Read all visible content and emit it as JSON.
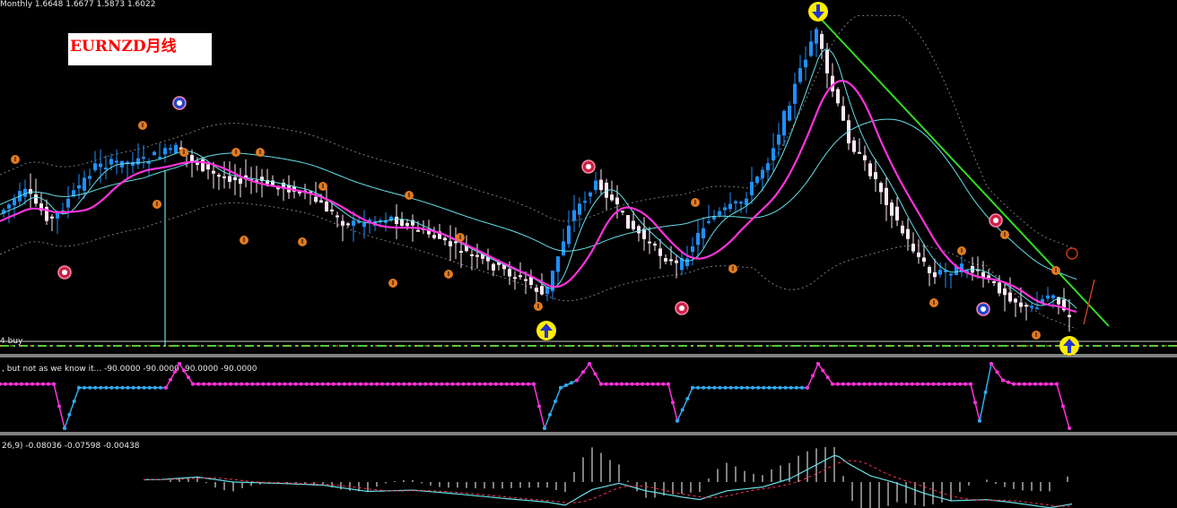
{
  "main_panel": {
    "header": "Monthly  1.6648 1.6677 1.5873 1.6022",
    "title": "EURNZD月线",
    "buy_label": "4 buy"
  },
  "indicator_panel": {
    "header": ", but not as we know it...  -90.0000 -90.0000 -90.0000 -90.0000"
  },
  "macd_panel": {
    "header": "26,9)  -0.08036 -0.07598 -0.00438"
  },
  "colors": {
    "background": "#000000",
    "bull_candle": "#1e90ff",
    "bear_candle": "#ffe8f4",
    "ma_main": "#ff33dd",
    "ma_fast": "#66e0e8",
    "bands": "#7a7a7a",
    "trendline": "#33dd22",
    "buy_line": "#44cc44",
    "support_line": "#e0a020",
    "fractal": "#e07a20",
    "arrow_marker": "#ffee00",
    "osc_pink": "#ff33dd",
    "osc_blue": "#33aaee",
    "macd_signal": "#ff3355"
  },
  "chart_data": [
    {
      "type": "line",
      "panel": "price",
      "symbol": "EURNZD",
      "timeframe": "Monthly",
      "ohlc_last": {
        "open": 1.6648,
        "high": 1.6677,
        "low": 1.5873,
        "close": 1.6022
      },
      "trend": {
        "price_path_points": [
          [
            0,
            0.62
          ],
          [
            30,
            0.55
          ],
          [
            60,
            0.64
          ],
          [
            110,
            0.47
          ],
          [
            160,
            0.46
          ],
          [
            200,
            0.42
          ],
          [
            240,
            0.5
          ],
          [
            290,
            0.52
          ],
          [
            340,
            0.55
          ],
          [
            390,
            0.65
          ],
          [
            440,
            0.63
          ],
          [
            490,
            0.69
          ],
          [
            540,
            0.76
          ],
          [
            590,
            0.82
          ],
          [
            610,
            0.87
          ],
          [
            640,
            0.62
          ],
          [
            670,
            0.52
          ],
          [
            700,
            0.64
          ],
          [
            740,
            0.74
          ],
          [
            760,
            0.78
          ],
          [
            790,
            0.64
          ],
          [
            830,
            0.58
          ],
          [
            860,
            0.45
          ],
          [
            880,
            0.3
          ],
          [
            900,
            0.15
          ],
          [
            912,
            0.06
          ],
          [
            925,
            0.2
          ],
          [
            950,
            0.4
          ],
          [
            980,
            0.52
          ],
          [
            1010,
            0.68
          ],
          [
            1040,
            0.8
          ],
          [
            1080,
            0.78
          ],
          [
            1110,
            0.83
          ],
          [
            1150,
            0.91
          ],
          [
            1175,
            0.85
          ],
          [
            1192,
            0.93
          ]
        ]
      },
      "markers": {
        "buy_arrows_x": [
          610,
          1192
        ],
        "sell_arrows_x": [
          912
        ],
        "dot_markers_x": [
          72,
          200,
          655,
          760,
          1110
        ]
      }
    },
    {
      "type": "line",
      "panel": "oscillator",
      "min": -90,
      "max": 90,
      "values_last": [
        -90.0,
        -90.0,
        -90.0,
        -90.0
      ]
    },
    {
      "type": "line",
      "panel": "macd",
      "params_partial": "26,9",
      "values_last": {
        "macd": -0.08036,
        "signal": -0.07598,
        "hist": -0.00438
      }
    }
  ]
}
